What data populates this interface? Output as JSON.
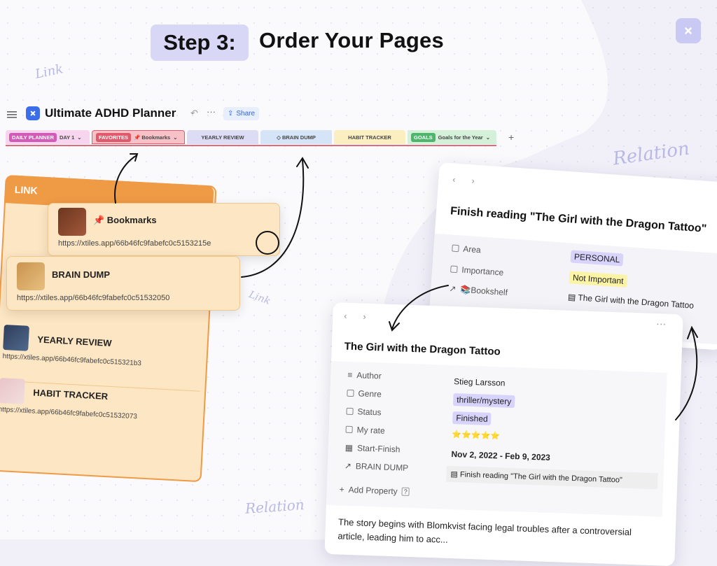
{
  "header": {
    "step_label": "Step 3:",
    "title": "Order Your Pages"
  },
  "handwritten": {
    "link_1": "Link",
    "link_2": "Link",
    "relation_1": "Relation",
    "relation_2": "Relation"
  },
  "app": {
    "title": "Ultimate ADHD Planner",
    "undo_icon": "undo-icon",
    "more": "···",
    "share_label": "Share"
  },
  "tabs": [
    {
      "tag": "DAILY PLANNER",
      "tag_color": "#d35bb8",
      "label": "DAY 1",
      "bg": "#f7d5ee",
      "chevron": true
    },
    {
      "tag": "FAVORITES",
      "tag_color": "#e05a6b",
      "label": "📌 Bookmarks",
      "bg": "#f6c1c7",
      "chevron": true
    },
    {
      "tag": "",
      "label": "YEARLY REVIEW",
      "bg": "#dcdcf5",
      "chevron": false
    },
    {
      "tag": "",
      "label": "◇ BRAIN DUMP",
      "bg": "#d6e4f7",
      "chevron": false
    },
    {
      "tag": "",
      "label": "HABIT TRACKER",
      "bg": "#fbefc2",
      "chevron": false
    },
    {
      "tag": "GOALS",
      "tag_color": "#4fb56d",
      "label": "Goals for the Year",
      "bg": "#d4f0d9",
      "chevron": true
    }
  ],
  "link_panel": {
    "header": "LINK",
    "bookmarks": {
      "title": "📌 Bookmarks",
      "url": "https://xtiles.app/66b46fc9fabefc0c5153215e"
    },
    "brain_dump": {
      "title": "BRAIN DUMP",
      "url": "https://xtiles.app/66b46fc9fabefc0c51532050"
    },
    "yearly_review": {
      "title": "YEARLY REVIEW",
      "url": "https://xtiles.app/66b46fc9fabefc0c515321b3"
    },
    "habit_tracker": {
      "title": "HABIT TRACKER",
      "url": "https://xtiles.app/66b46fc9fabefc0c51532073"
    }
  },
  "task_card": {
    "title": "Finish reading \"The Girl with the Dragon Tattoo\"",
    "props": [
      {
        "label": "Area",
        "value": "PERSONAL",
        "chip_bg": "#d8d3fb"
      },
      {
        "label": "Importance",
        "value": "Not Important",
        "chip_bg": "#fbf3a6"
      },
      {
        "label": "📚Bookshelf",
        "value": "The Girl with the Dragon Tattoo",
        "chip_bg": ""
      }
    ]
  },
  "book_card": {
    "title": "The Girl with the Dragon Tattoo",
    "props": [
      {
        "label": "Author",
        "value": "Stieg Larsson",
        "chip_bg": ""
      },
      {
        "label": "Genre",
        "value": "thriller/mystery",
        "chip_bg": "#d8d3fb"
      },
      {
        "label": "Status",
        "value": "Finished",
        "chip_bg": "#d8d3fb"
      },
      {
        "label": "My rate",
        "value": "⭐⭐⭐⭐⭐",
        "chip_bg": ""
      },
      {
        "label": "Start-Finish",
        "value": "Nov 2, 2022 - Feb 9, 2023",
        "chip_bg": ""
      },
      {
        "label": "BRAIN DUMP",
        "value": "Finish reading \"The Girl with the Dragon Tattoo\"",
        "chip_bg": "#f0f0f0"
      }
    ],
    "add_property": "Add Property",
    "body_text": "The story begins with Blomkvist facing legal troubles after a controversial article, leading him to acc..."
  }
}
